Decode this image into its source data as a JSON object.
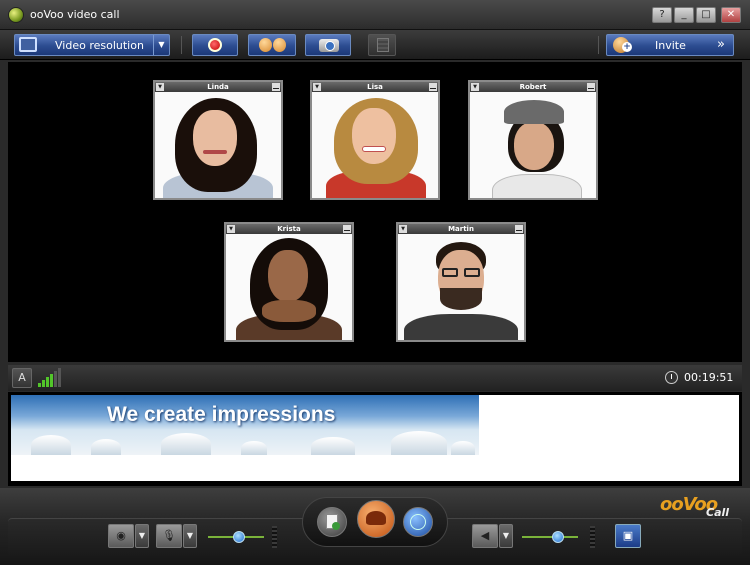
{
  "window": {
    "title": "ooVoo video call"
  },
  "window_buttons": [
    {
      "name": "help-button",
      "glyph": "?"
    },
    {
      "name": "minimize-button",
      "glyph": "_"
    },
    {
      "name": "maximize-button",
      "glyph": "□"
    },
    {
      "name": "close-button",
      "glyph": "✕"
    }
  ],
  "toolbar": {
    "video_resolution_label": "Video resolution",
    "invite_label": "Invite",
    "invite_chevron": "»",
    "dropdown_glyph": "▼"
  },
  "participants": [
    {
      "name": "Linda"
    },
    {
      "name": "Lisa"
    },
    {
      "name": "Robert"
    },
    {
      "name": "Krista"
    },
    {
      "name": "Martin"
    }
  ],
  "status": {
    "timer": "00:19:51",
    "signal_bars": 4,
    "signal_bars_total": 6
  },
  "ad": {
    "headline": "We create impressions"
  },
  "volume": {
    "mic_level": 0.55,
    "speaker_level": 0.65
  },
  "brand": {
    "logo": "ooVoo",
    "sub": "Call",
    "accent": "#2c4c90",
    "logo_color": "#e8a020"
  }
}
